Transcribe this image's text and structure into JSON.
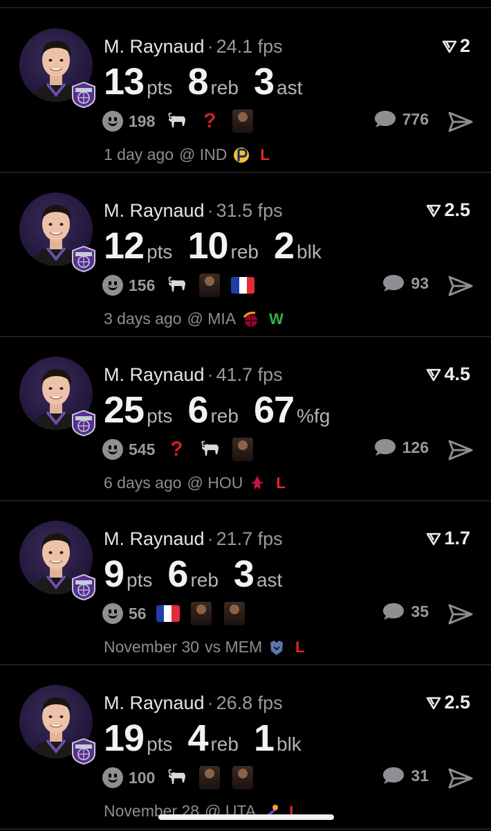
{
  "colors": {
    "background": "#000000",
    "loss": "#e8252a",
    "win": "#2fb24c",
    "muted": "#8e8e8e"
  },
  "posts": [
    {
      "player": "M. Raynaud",
      "fps": "24.1 fps",
      "line": "2",
      "stats": [
        {
          "value": "13",
          "unit": "pts"
        },
        {
          "value": "8",
          "unit": "reb"
        },
        {
          "value": "3",
          "unit": "ast"
        }
      ],
      "smile_count": "198",
      "reactions": [
        "goat-icon",
        "question-icon",
        "meme-photo-icon"
      ],
      "comment_count": "776",
      "date": "1 day ago",
      "venue": "@ IND",
      "opponent_logo": "pacers-logo-icon",
      "result": "L"
    },
    {
      "player": "M. Raynaud",
      "fps": "31.5 fps",
      "line": "2.5",
      "stats": [
        {
          "value": "12",
          "unit": "pts"
        },
        {
          "value": "10",
          "unit": "reb"
        },
        {
          "value": "2",
          "unit": "blk"
        }
      ],
      "smile_count": "156",
      "reactions": [
        "goat-icon",
        "meme-photo-icon",
        "france-flag-icon"
      ],
      "comment_count": "93",
      "date": "3 days ago",
      "venue": "@ MIA",
      "opponent_logo": "heat-logo-icon",
      "result": "W"
    },
    {
      "player": "M. Raynaud",
      "fps": "41.7 fps",
      "line": "4.5",
      "stats": [
        {
          "value": "25",
          "unit": "pts"
        },
        {
          "value": "6",
          "unit": "reb"
        },
        {
          "value": "67",
          "unit": "%fg"
        }
      ],
      "smile_count": "545",
      "reactions": [
        "question-icon",
        "goat-icon",
        "meme-photo-icon"
      ],
      "comment_count": "126",
      "date": "6 days ago",
      "venue": "@ HOU",
      "opponent_logo": "rockets-logo-icon",
      "result": "L"
    },
    {
      "player": "M. Raynaud",
      "fps": "21.7 fps",
      "line": "1.7",
      "stats": [
        {
          "value": "9",
          "unit": "pts"
        },
        {
          "value": "6",
          "unit": "reb"
        },
        {
          "value": "3",
          "unit": "ast"
        }
      ],
      "smile_count": "56",
      "reactions": [
        "france-flag-icon",
        "meme-photo-icon",
        "meme-photo-icon"
      ],
      "comment_count": "35",
      "date": "November 30",
      "venue": "vs MEM",
      "opponent_logo": "grizzlies-logo-icon",
      "result": "L"
    },
    {
      "player": "M. Raynaud",
      "fps": "26.8 fps",
      "line": "2.5",
      "stats": [
        {
          "value": "19",
          "unit": "pts"
        },
        {
          "value": "4",
          "unit": "reb"
        },
        {
          "value": "1",
          "unit": "blk"
        }
      ],
      "smile_count": "100",
      "reactions": [
        "goat-icon",
        "meme-photo-icon",
        "meme-photo-icon"
      ],
      "comment_count": "31",
      "date": "November 28",
      "venue": "@ UTA",
      "opponent_logo": "jazz-logo-icon",
      "result": "L"
    }
  ]
}
